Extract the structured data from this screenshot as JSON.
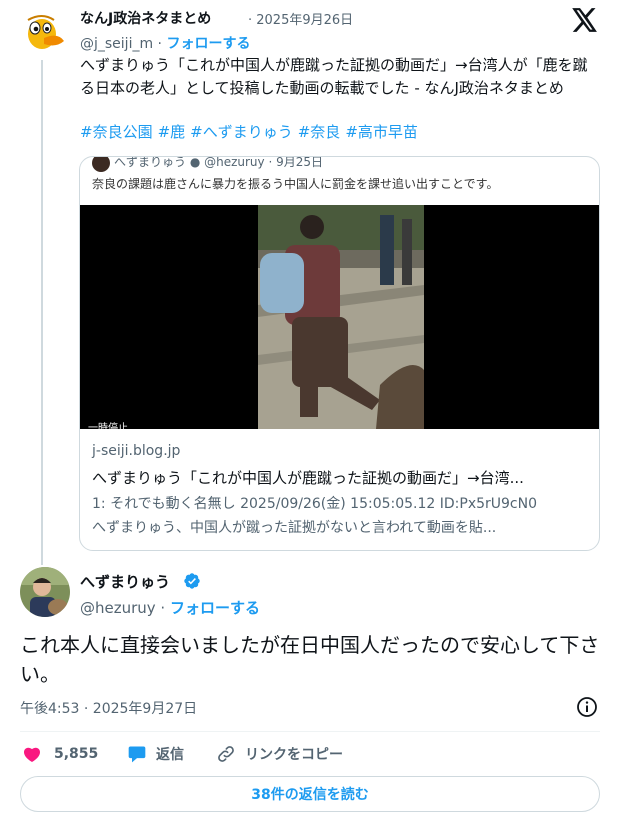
{
  "quoted_tweet": {
    "author_name": "なんJ政治ネタまとめ",
    "date": "· 2025年9月26日",
    "handle": "@j_seiji_m ·",
    "follow_label": "フォローする",
    "text": "へずまりゅう「これが中国人が鹿蹴った証拠の動画だ」→台湾人が「鹿を蹴る日本の老人」として投稿した動画の転載でした - なんJ政治ネタまとめ",
    "hashtags": [
      "#奈良公園",
      "#鹿",
      "#へずまりゅう",
      "#奈良",
      "#高市早苗"
    ],
    "card": {
      "meta_text": "へずまりゅう ● @hezuruy · 9月25日",
      "caption": "奈良の課題は鹿さんに暴力を振るう中国人に罰金を課せ追い出すことです。",
      "video_label": "一時停止",
      "domain": "j-seiji.blog.jp",
      "title": "へずまりゅう「これが中国人が鹿蹴った証拠の動画だ」→台湾...",
      "line1": "1: それでも動く名無し 2025/09/26(金) 15:05:05.12 ID:Px5rU9cN0",
      "line2": "へずまりゅう、中国人が蹴った証拠がないと言われて動画を貼..."
    }
  },
  "main_tweet": {
    "author_name": "へずまりゅう",
    "handle": "@hezuruy ·",
    "follow_label": "フォローする",
    "text": "これ本人に直接会いましたが在日中国人だったので安心して下さい。",
    "timestamp": "午後4:53 · 2025年9月27日"
  },
  "actions": {
    "like_count": "5,855",
    "reply_label": "返信",
    "copy_link_label": "リンクをコピー",
    "read_replies_label": "38件の返信を読む"
  },
  "colors": {
    "accent": "#1d9bf0",
    "like": "#f91880",
    "muted": "#536471",
    "border": "#cfd9de"
  },
  "icons": [
    "x-logo-icon",
    "verified-icon",
    "info-icon",
    "heart-icon",
    "reply-bubble-icon",
    "link-icon"
  ]
}
